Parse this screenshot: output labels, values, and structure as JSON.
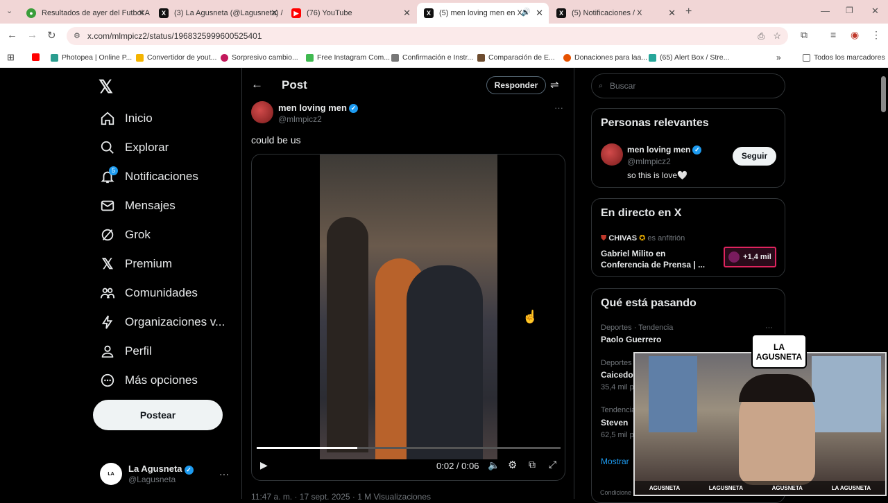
{
  "browser": {
    "tabs": [
      {
        "title": "Resultados de ayer del Futbol A",
        "icon": "green-globe"
      },
      {
        "title": "(3) La Agusneta (@Lagusneta) /",
        "icon": "x"
      },
      {
        "title": "(76) YouTube",
        "icon": "youtube"
      },
      {
        "title": "(5) men loving men en X: \"c",
        "icon": "x",
        "active": true
      },
      {
        "title": "(5) Notificaciones / X",
        "icon": "x"
      }
    ],
    "url": "x.com/mlmpicz2/status/1968325999600525401",
    "bookmarks": [
      "Photopea | Online P...",
      "Convertidor de yout...",
      "Sorpresivo cambio...",
      "Free Instagram Com...",
      "Confirmación e Instr...",
      "Comparación de E...",
      "Donaciones para laa...",
      "(65) Alert Box / Stre..."
    ],
    "all_bookmarks": "Todos los marcadores"
  },
  "sidebar": {
    "items": [
      {
        "label": "Inicio",
        "icon": "home-icon"
      },
      {
        "label": "Explorar",
        "icon": "search-icon"
      },
      {
        "label": "Notificaciones",
        "icon": "bell-icon",
        "badge": "5"
      },
      {
        "label": "Mensajes",
        "icon": "mail-icon"
      },
      {
        "label": "Grok",
        "icon": "grok-icon"
      },
      {
        "label": "Premium",
        "icon": "x-icon"
      },
      {
        "label": "Comunidades",
        "icon": "people-icon"
      },
      {
        "label": "Organizaciones v...",
        "icon": "bolt-icon"
      },
      {
        "label": "Perfil",
        "icon": "person-icon"
      },
      {
        "label": "Más opciones",
        "icon": "more-circle-icon"
      }
    ],
    "post_button": "Postear",
    "account": {
      "name": "La Agusneta",
      "handle": "@Lagusneta"
    }
  },
  "main": {
    "title": "Post",
    "reply_button": "Responder",
    "author": {
      "name": "men loving men",
      "handle": "@mlmpicz2"
    },
    "text": "could be us",
    "video": {
      "time": "0:02 / 0:06",
      "progress": 0.33
    },
    "footer": "11:47 a. m. · 17 sept. 2025 · 1 M Visualizaciones"
  },
  "right": {
    "search_placeholder": "Buscar",
    "relevant": {
      "title": "Personas relevantes",
      "name": "men loving men",
      "handle": "@mlmpicz2",
      "bio": "so this is love🤍",
      "follow": "Seguir"
    },
    "live": {
      "title": "En directo en X",
      "host": "CHIVAS",
      "host_role": "es anfitrión",
      "event": "Gabriel Milito en Conferencia de Prensa | ...",
      "listeners": "+1,4 mil"
    },
    "trends": {
      "title": "Qué está pasando",
      "items": [
        {
          "meta": "Deportes · Tendencia",
          "name": "Paolo Guerrero",
          "count": ""
        },
        {
          "meta": "Deportes",
          "name": "Caicedo",
          "count": "35,4 mil p"
        },
        {
          "meta": "Tendencia",
          "name": "Steven",
          "count": "62,5 mil p"
        }
      ],
      "more": "Mostrar",
      "footer": "Condicione"
    }
  },
  "overlay": {
    "brand": "LA AGUSNETA",
    "socials": [
      "AGUSNETA",
      "LAGUSNETA",
      "AGUSNETA",
      "LA AGUSNETA"
    ]
  }
}
